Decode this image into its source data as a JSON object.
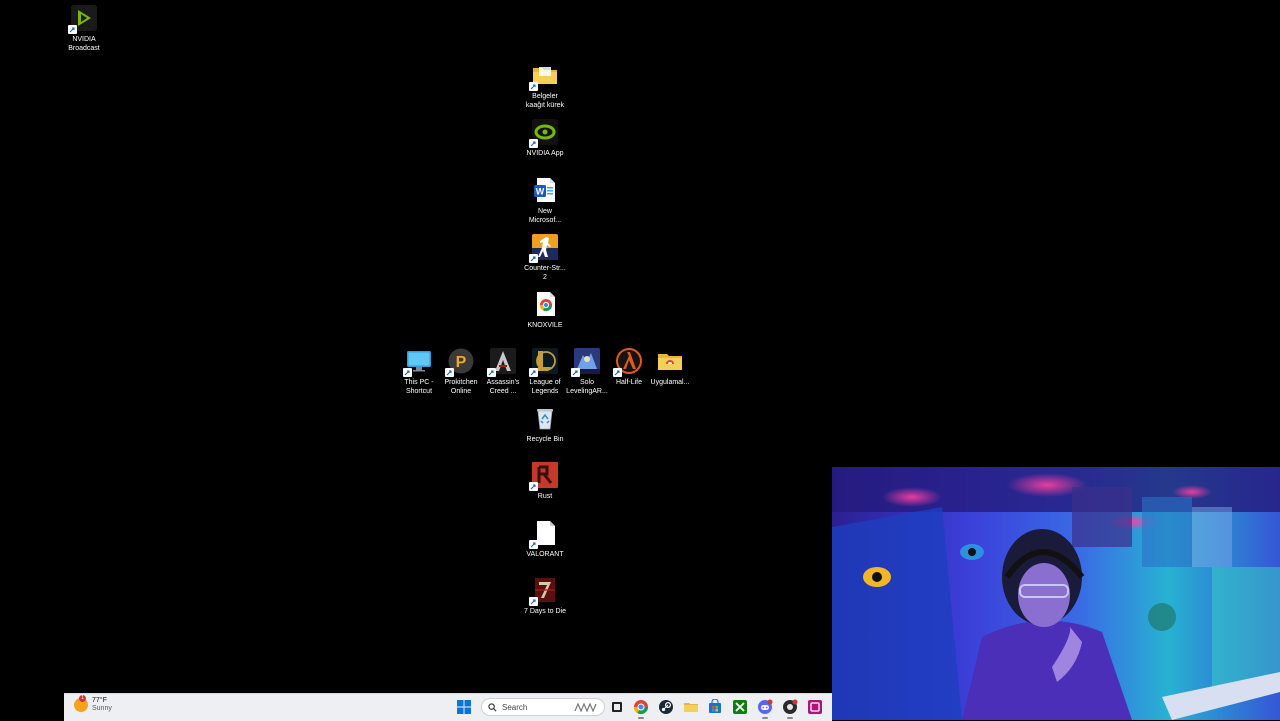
{
  "desktop": {
    "icons": [
      {
        "id": "nvidia-broadcast",
        "label": "NVIDIA\nBroadcast",
        "icon": "nvidia-broadcast-icon"
      },
      {
        "id": "belgeler",
        "label": "Belgeler\nkaağıt kürek",
        "icon": "folder-icon"
      },
      {
        "id": "nvidia-app",
        "label": "NVIDIA App",
        "icon": "nvidia-app-icon"
      },
      {
        "id": "new-microsoft",
        "label": "New\nMicrosof...",
        "icon": "word-document-icon"
      },
      {
        "id": "counter-strike",
        "label": "Counter-Str...\n2",
        "icon": "counter-strike-icon"
      },
      {
        "id": "knoxvile",
        "label": "KNOXVILE",
        "icon": "chrome-file-icon"
      },
      {
        "id": "this-pc",
        "label": "This PC -\nShortcut",
        "icon": "monitor-icon"
      },
      {
        "id": "prokitchen",
        "label": "Prokitchen\nOnline",
        "icon": "prokitchen-icon"
      },
      {
        "id": "assassins-creed",
        "label": "Assassin's\nCreed ...",
        "icon": "assassins-creed-icon"
      },
      {
        "id": "league-of-legends",
        "label": "League of\nLegends",
        "icon": "league-of-legends-icon"
      },
      {
        "id": "solo-leveling",
        "label": "Solo\nLevelingAR...",
        "icon": "solo-leveling-icon"
      },
      {
        "id": "half-life",
        "label": "Half-Life",
        "icon": "half-life-icon"
      },
      {
        "id": "uygulamalar",
        "label": "Uygulamal...",
        "icon": "folder-icon"
      },
      {
        "id": "recycle-bin",
        "label": "Recycle Bin",
        "icon": "recycle-bin-icon"
      },
      {
        "id": "rust",
        "label": "Rust",
        "icon": "rust-icon"
      },
      {
        "id": "valorant",
        "label": "VALORANT",
        "icon": "blank-file-icon"
      },
      {
        "id": "seven-days",
        "label": "7 Days to Die",
        "icon": "seven-days-icon"
      }
    ]
  },
  "taskbar": {
    "weather": {
      "temp": "77°F",
      "condition": "Sunny",
      "badge": "1"
    },
    "search": {
      "label": "Search"
    },
    "apps": [
      {
        "id": "start",
        "icon": "windows-start-icon"
      },
      {
        "id": "task-view",
        "icon": "task-view-icon"
      },
      {
        "id": "chrome",
        "icon": "chrome-icon"
      },
      {
        "id": "steam",
        "icon": "steam-icon"
      },
      {
        "id": "file-explorer",
        "icon": "file-explorer-icon"
      },
      {
        "id": "store",
        "icon": "microsoft-store-icon"
      },
      {
        "id": "xbox",
        "icon": "xbox-icon"
      },
      {
        "id": "discord",
        "icon": "discord-icon"
      },
      {
        "id": "app-red",
        "icon": "app-icon"
      },
      {
        "id": "app-purple",
        "icon": "app-icon"
      }
    ]
  },
  "colors": {
    "desktop_bg": "#000000",
    "taskbar_bg": "#eeeff2",
    "accent": "#0078d4"
  }
}
